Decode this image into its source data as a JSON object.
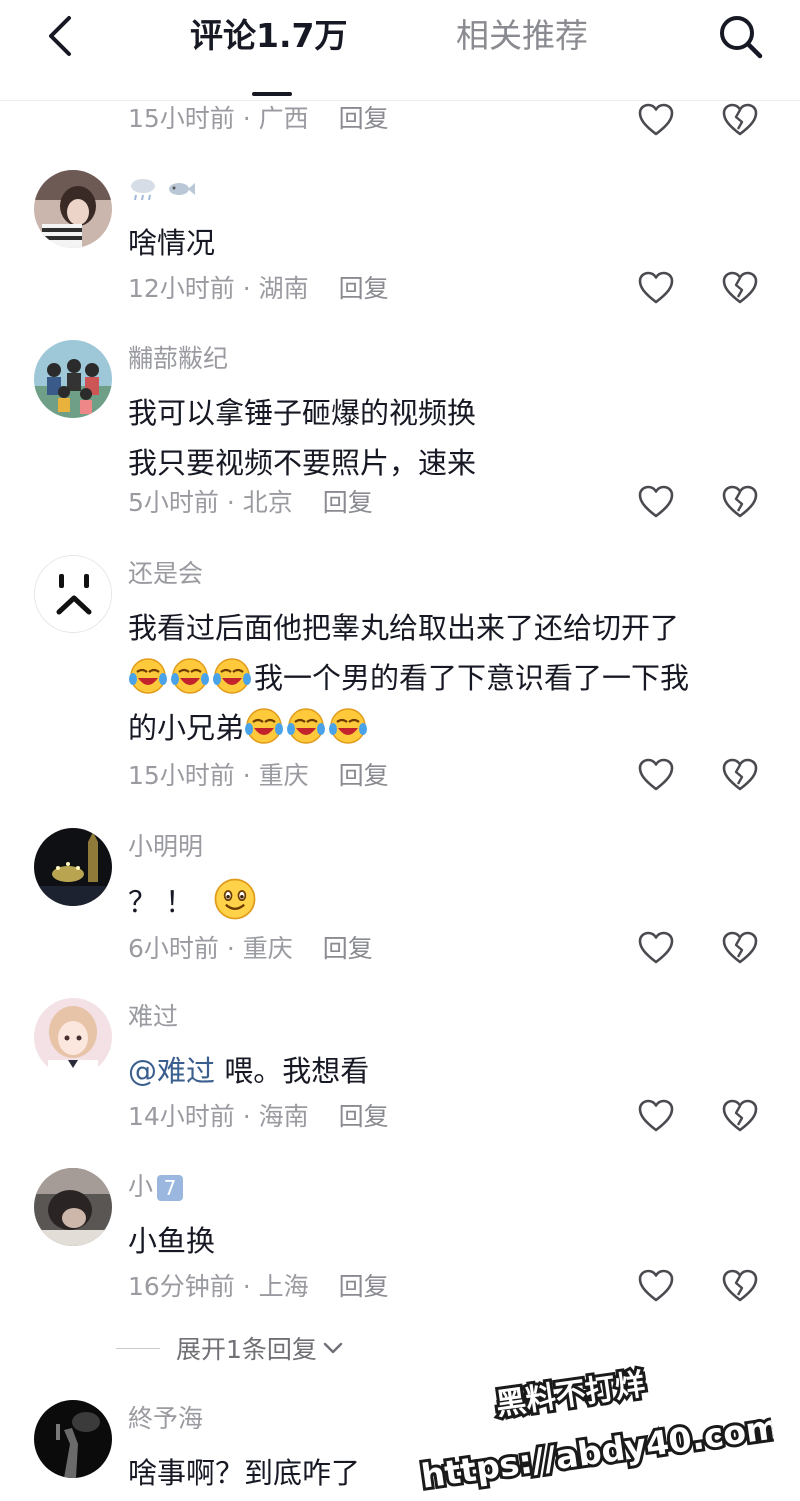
{
  "header": {
    "tabs": [
      {
        "label": "评论1.7万",
        "active": true
      },
      {
        "label": "相关推荐",
        "active": false
      }
    ],
    "icons": {
      "back": "chevron-left-icon",
      "search": "search-icon"
    }
  },
  "colors": {
    "primary_text": "#161823",
    "secondary_text": "#9a9ba1",
    "mention": "#3a5f8f",
    "divider": "#ececec"
  },
  "comments": [
    {
      "meta": "15小时前 · 广西",
      "reply": "回复"
    },
    {
      "username_emojis": [
        "rain-cloud-icon",
        "fish-icon"
      ],
      "lines": [
        "啥情况"
      ],
      "meta": "12小时前 · 湖南",
      "reply": "回复"
    },
    {
      "username": "黼蔀黻纪",
      "lines": [
        "我可以拿锤子砸爆的视频换",
        "我只要视频不要照片，速来"
      ],
      "meta": "5小时前 · 北京",
      "reply": "回复"
    },
    {
      "username": "还是会",
      "lines": [
        "我看过后面他把睾丸给取出来了还给切开了",
        "我一个男的看了下意识看了一下我",
        "的小兄弟"
      ],
      "meta": "15小时前 · 重庆",
      "reply": "回复"
    },
    {
      "username": "小明明",
      "lines": [
        "？！"
      ],
      "meta": "6小时前 · 重庆",
      "reply": "回复"
    },
    {
      "username": "难过",
      "mention": "@难过",
      "lines": [
        "喂。我想看"
      ],
      "meta": "14小时前 · 海南",
      "reply": "回复"
    },
    {
      "username": "小",
      "badge": "7",
      "lines": [
        "小鱼换"
      ],
      "meta": "16分钟前 · 上海",
      "reply": "回复"
    },
    {
      "username": "終予海",
      "lines": [
        "啥事啊？到底咋了"
      ]
    }
  ],
  "expand_replies": {
    "label": "展开1条回复"
  },
  "watermark": {
    "line1": "黑料不打烊",
    "line2": "https://abdy40.com"
  }
}
